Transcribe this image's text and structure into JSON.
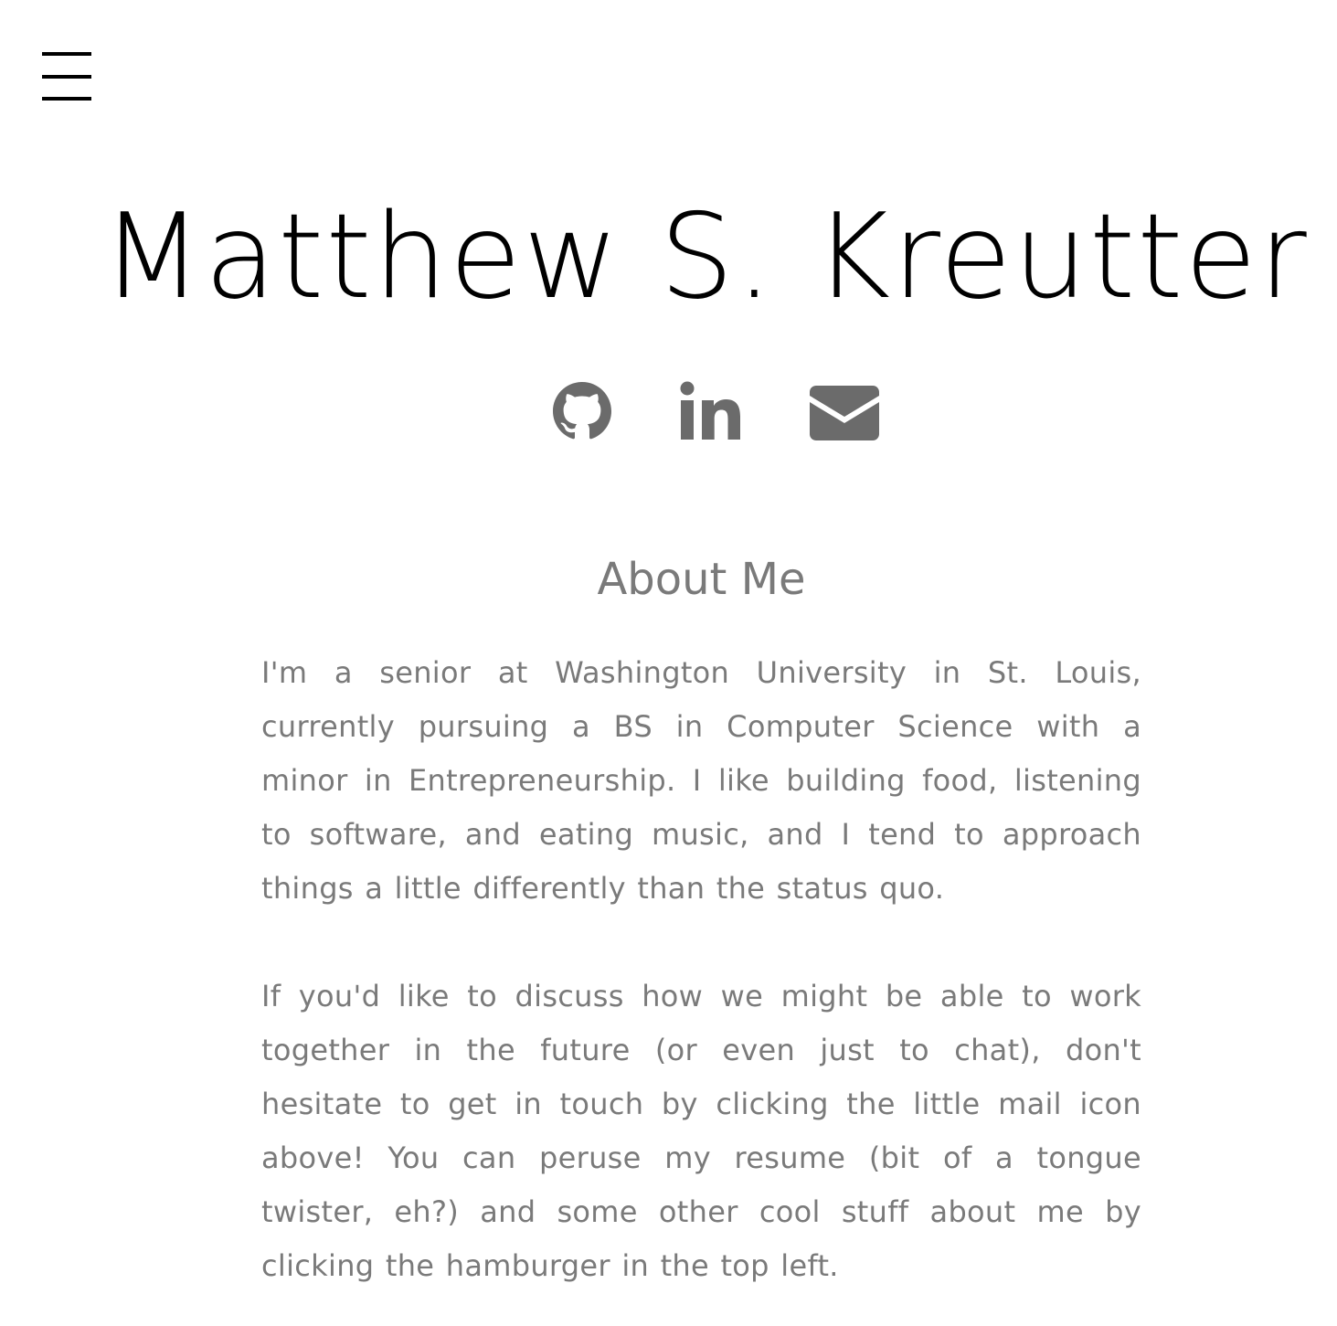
{
  "menu": {
    "icon": "hamburger-menu-icon"
  },
  "header": {
    "title": "Matthew S. Kreutter"
  },
  "social": [
    {
      "name": "GitHub",
      "icon": "github-icon"
    },
    {
      "name": "LinkedIn",
      "icon": "linkedin-icon"
    },
    {
      "name": "Email",
      "icon": "mail-icon"
    }
  ],
  "about": {
    "heading": "About Me",
    "paragraphs": [
      "I'm a senior at Washington University in St. Louis, currently pursuing a BS in Computer Science with a minor in Entrepreneurship. I like building food, listening to software, and eating music, and I tend to approach things a little differently than the status quo.",
      "If you'd like to discuss how we might be able to work together in the future (or even just to chat), don't hesitate to get in touch by clicking the little mail icon above! You can peruse my resume (bit of a tongue twister, eh?) and some other cool stuff about me by clicking the hamburger in the top left."
    ]
  },
  "colors": {
    "title": "#000000",
    "icons": "#6b6b6b",
    "text": "#7a7a7a",
    "background": "#ffffff"
  }
}
